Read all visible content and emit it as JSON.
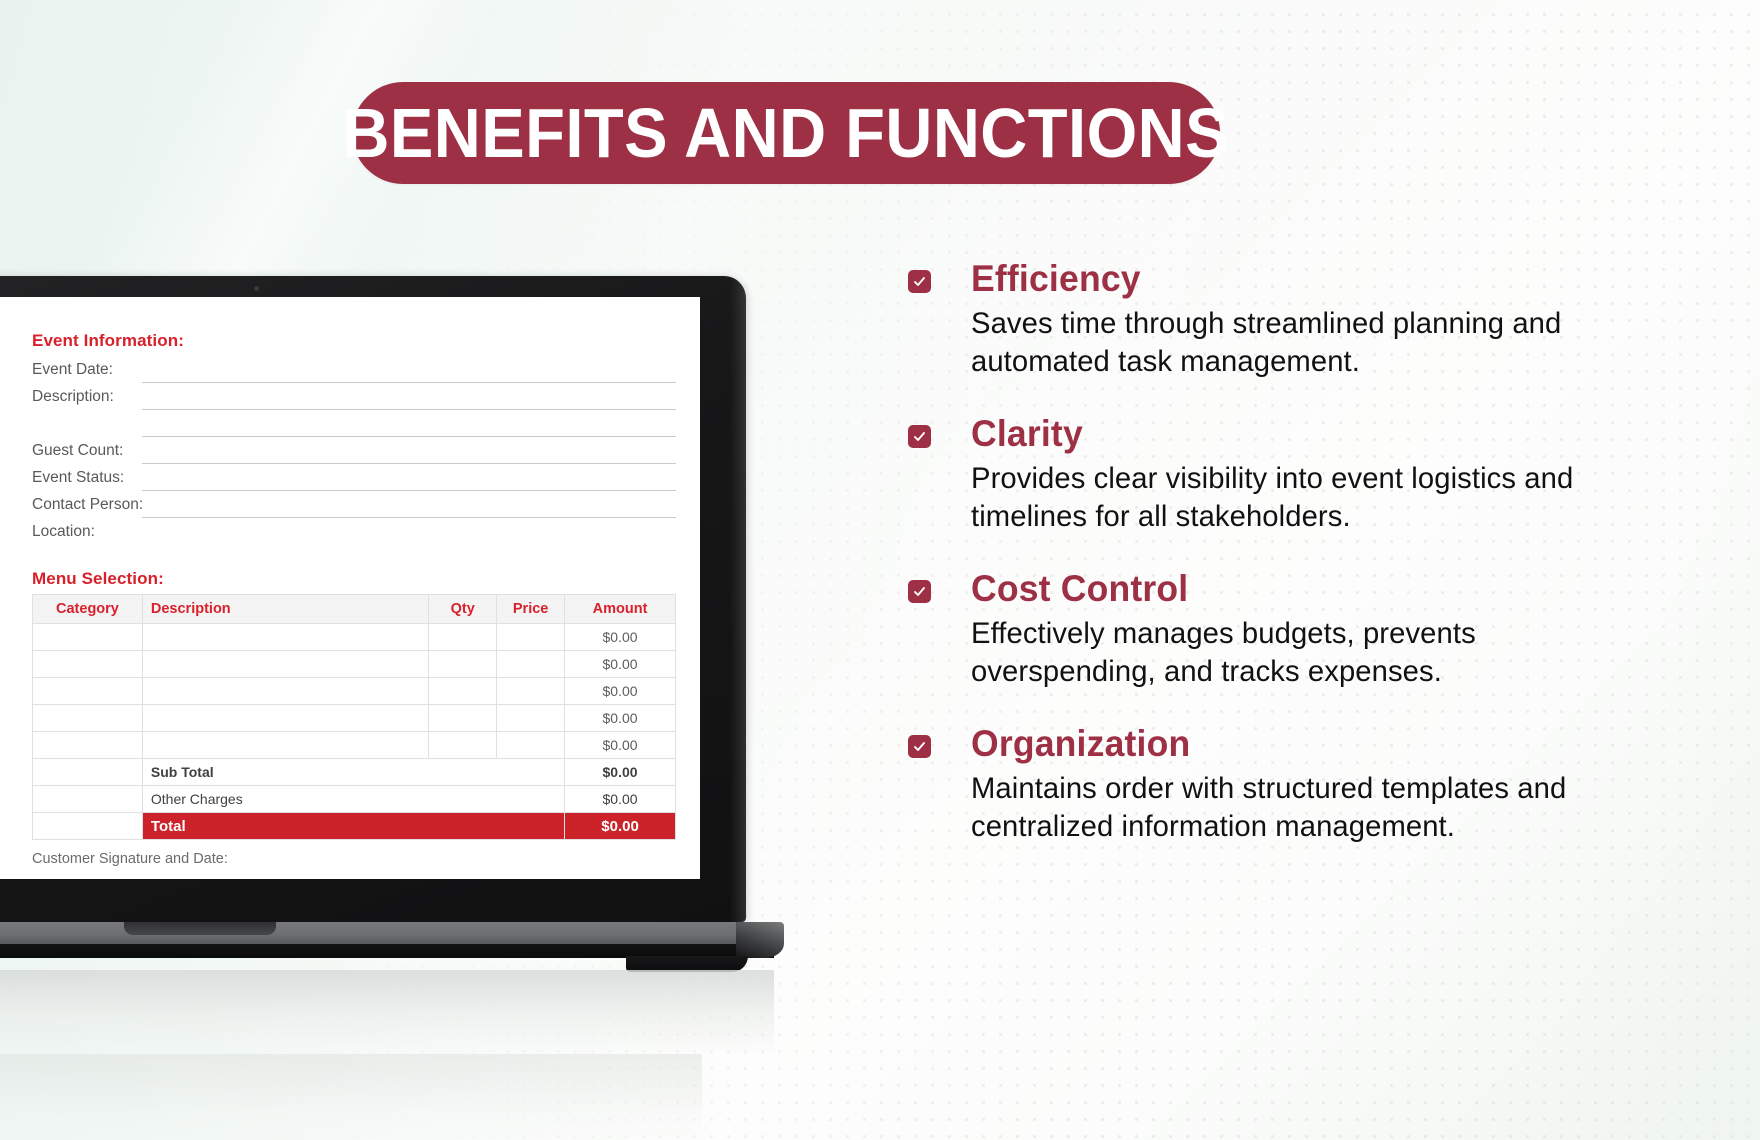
{
  "banner": {
    "title": "BENEFITS AND FUNCTIONS"
  },
  "colors": {
    "banner_bg": "#9d3044",
    "heading_red": "#9d3044",
    "doc_red": "#d8212b",
    "total_bar": "#cc2229",
    "label_gray": "#58595b"
  },
  "document": {
    "event_section_title": "Event Information:",
    "fields": [
      {
        "label": "Event Date:"
      },
      {
        "label": "Description:"
      },
      {
        "label": ""
      },
      {
        "label": "Guest Count:"
      },
      {
        "label": "Event Status:"
      },
      {
        "label": "Contact Person:"
      },
      {
        "label": "Location:"
      }
    ],
    "menu_section_title": "Menu Selection:",
    "table": {
      "columns": [
        "Category",
        "Description",
        "Qty",
        "Price",
        "Amount"
      ],
      "rows": [
        {
          "category": "",
          "description": "",
          "qty": "",
          "price": "",
          "amount": "$0.00"
        },
        {
          "category": "",
          "description": "",
          "qty": "",
          "price": "",
          "amount": "$0.00"
        },
        {
          "category": "",
          "description": "",
          "qty": "",
          "price": "",
          "amount": "$0.00"
        },
        {
          "category": "",
          "description": "",
          "qty": "",
          "price": "",
          "amount": "$0.00"
        },
        {
          "category": "",
          "description": "",
          "qty": "",
          "price": "",
          "amount": "$0.00"
        }
      ],
      "summary": [
        {
          "label": "Sub Total",
          "value": "$0.00"
        },
        {
          "label": "Other Charges",
          "value": "$0.00"
        }
      ],
      "total": {
        "label": "Total",
        "value": "$0.00"
      }
    },
    "signature_label": "Customer Signature and Date:"
  },
  "benefits": [
    {
      "icon": "check-icon",
      "title": "Efficiency",
      "description": "Saves time through streamlined planning and automated task management."
    },
    {
      "icon": "check-icon",
      "title": "Clarity",
      "description": "Provides clear visibility into event logistics and timelines for all stakeholders."
    },
    {
      "icon": "check-icon",
      "title": "Cost Control",
      "description": "Effectively manages budgets, prevents overspending, and tracks expenses."
    },
    {
      "icon": "check-icon",
      "title": "Organization",
      "description": "Maintains order with structured templates and centralized information management."
    }
  ]
}
